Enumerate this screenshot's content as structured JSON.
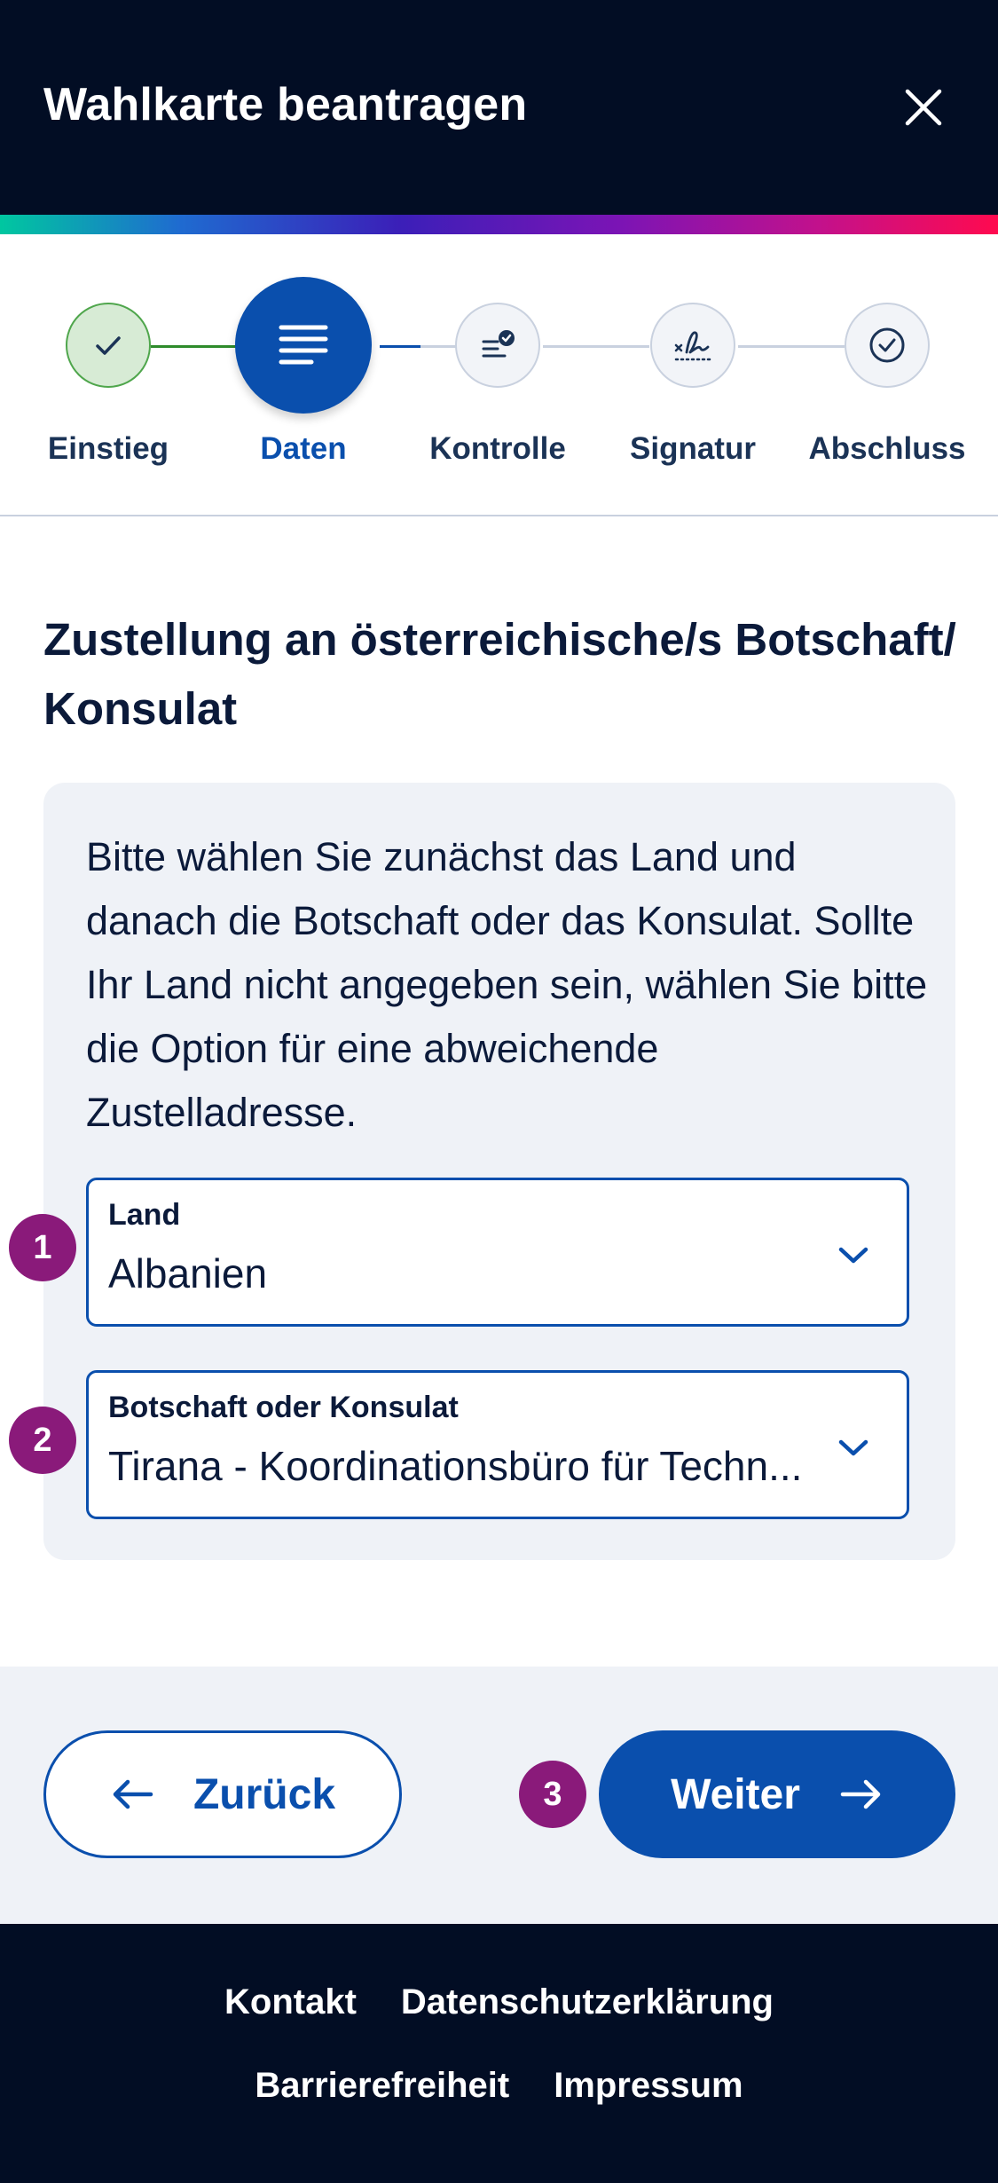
{
  "header": {
    "title": "Wahlkarte beantragen",
    "close_icon": "close-icon"
  },
  "stepper": {
    "steps": [
      {
        "label": "Einstieg",
        "status": "done",
        "icon": "check-icon"
      },
      {
        "label": "Daten",
        "status": "active",
        "icon": "lines-icon"
      },
      {
        "label": "Kontrolle",
        "status": "pending",
        "icon": "list-check-icon"
      },
      {
        "label": "Signatur",
        "status": "pending",
        "icon": "signature-icon"
      },
      {
        "label": "Abschluss",
        "status": "pending",
        "icon": "circle-check-icon"
      }
    ]
  },
  "main": {
    "title": "Zustellung an österreichische/s Botschaft/ Konsulat",
    "description": "Bitte wählen Sie zunächst das Land und danach die Botschaft oder das Konsulat. Sollte Ihr Land nicht angegeben sein, wählen Sie bitte die Option für eine abweichende Zustelladresse.",
    "country_select": {
      "label": "Land",
      "value": "Albanien"
    },
    "embassy_select": {
      "label": "Botschaft oder Konsulat",
      "value": "Tirana - Koordinationsbüro für Techn..."
    }
  },
  "badges": [
    "1",
    "2",
    "3"
  ],
  "actions": {
    "back_label": "Zurück",
    "next_label": "Weiter"
  },
  "footer": {
    "links": [
      "Kontakt",
      "Datenschutzerklärung",
      "Barrierefreiheit",
      "Impressum"
    ]
  },
  "colors": {
    "header_bg": "#020d24",
    "primary": "#0a4fad",
    "badge": "#8a1a7a",
    "success": "#4fa64c",
    "card_bg": "#eff2f7"
  }
}
